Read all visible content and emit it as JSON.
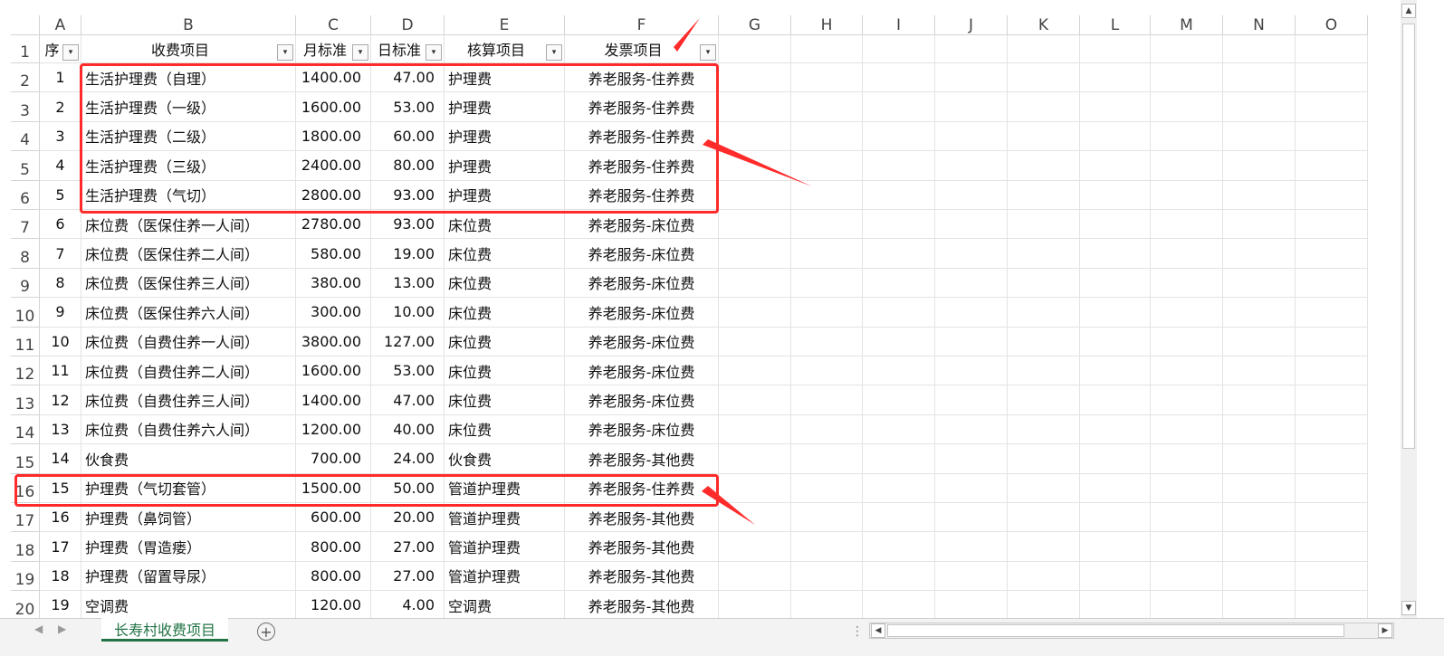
{
  "columns": [
    "A",
    "B",
    "C",
    "D",
    "E",
    "F",
    "G",
    "H",
    "I",
    "J",
    "K",
    "L",
    "M",
    "N",
    "O"
  ],
  "header_row_number": "1",
  "headers": {
    "seq": "序",
    "item": "收费项目",
    "monthly": "月标准",
    "daily": "日标准",
    "account": "核算项目",
    "invoice": "发票项目"
  },
  "rows": [
    {
      "row": "2",
      "seq": "1",
      "item": "生活护理费（自理）",
      "monthly": "1400.00",
      "daily": "47.00",
      "account": "护理费",
      "invoice": "养老服务-住养费"
    },
    {
      "row": "3",
      "seq": "2",
      "item": "生活护理费（一级）",
      "monthly": "1600.00",
      "daily": "53.00",
      "account": "护理费",
      "invoice": "养老服务-住养费"
    },
    {
      "row": "4",
      "seq": "3",
      "item": "生活护理费（二级）",
      "monthly": "1800.00",
      "daily": "60.00",
      "account": "护理费",
      "invoice": "养老服务-住养费"
    },
    {
      "row": "5",
      "seq": "4",
      "item": "生活护理费（三级）",
      "monthly": "2400.00",
      "daily": "80.00",
      "account": "护理费",
      "invoice": "养老服务-住养费"
    },
    {
      "row": "6",
      "seq": "5",
      "item": "生活护理费（气切）",
      "monthly": "2800.00",
      "daily": "93.00",
      "account": "护理费",
      "invoice": "养老服务-住养费"
    },
    {
      "row": "7",
      "seq": "6",
      "item": "床位费（医保住养一人间）",
      "monthly": "2780.00",
      "daily": "93.00",
      "account": "床位费",
      "invoice": "养老服务-床位费"
    },
    {
      "row": "8",
      "seq": "7",
      "item": "床位费（医保住养二人间）",
      "monthly": "580.00",
      "daily": "19.00",
      "account": "床位费",
      "invoice": "养老服务-床位费"
    },
    {
      "row": "9",
      "seq": "8",
      "item": "床位费（医保住养三人间）",
      "monthly": "380.00",
      "daily": "13.00",
      "account": "床位费",
      "invoice": "养老服务-床位费"
    },
    {
      "row": "10",
      "seq": "9",
      "item": "床位费（医保住养六人间）",
      "monthly": "300.00",
      "daily": "10.00",
      "account": "床位费",
      "invoice": "养老服务-床位费"
    },
    {
      "row": "11",
      "seq": "10",
      "item": "床位费（自费住养一人间）",
      "monthly": "3800.00",
      "daily": "127.00",
      "account": "床位费",
      "invoice": "养老服务-床位费"
    },
    {
      "row": "12",
      "seq": "11",
      "item": "床位费（自费住养二人间）",
      "monthly": "1600.00",
      "daily": "53.00",
      "account": "床位费",
      "invoice": "养老服务-床位费"
    },
    {
      "row": "13",
      "seq": "12",
      "item": "床位费（自费住养三人间）",
      "monthly": "1400.00",
      "daily": "47.00",
      "account": "床位费",
      "invoice": "养老服务-床位费"
    },
    {
      "row": "14",
      "seq": "13",
      "item": "床位费（自费住养六人间）",
      "monthly": "1200.00",
      "daily": "40.00",
      "account": "床位费",
      "invoice": "养老服务-床位费"
    },
    {
      "row": "15",
      "seq": "14",
      "item": "伙食费",
      "monthly": "700.00",
      "daily": "24.00",
      "account": "伙食费",
      "invoice": "养老服务-其他费"
    },
    {
      "row": "16",
      "seq": "15",
      "item": "护理费（气切套管）",
      "monthly": "1500.00",
      "daily": "50.00",
      "account": "管道护理费",
      "invoice": "养老服务-住养费"
    },
    {
      "row": "17",
      "seq": "16",
      "item": "护理费（鼻饲管）",
      "monthly": "600.00",
      "daily": "20.00",
      "account": "管道护理费",
      "invoice": "养老服务-其他费"
    },
    {
      "row": "18",
      "seq": "17",
      "item": "护理费（胃造瘘）",
      "monthly": "800.00",
      "daily": "27.00",
      "account": "管道护理费",
      "invoice": "养老服务-其他费"
    },
    {
      "row": "19",
      "seq": "18",
      "item": "护理费（留置导尿）",
      "monthly": "800.00",
      "daily": "27.00",
      "account": "管道护理费",
      "invoice": "养老服务-其他费"
    },
    {
      "row": "20",
      "seq": "19",
      "item": "空调费",
      "monthly": "120.00",
      "daily": "4.00",
      "account": "空调费",
      "invoice": "养老服务-其他费"
    }
  ],
  "sheet_tab": "长寿村收费项目",
  "add_sheet": "+",
  "colors": {
    "accent": "#217346",
    "highlight": "#ff2a2a"
  }
}
